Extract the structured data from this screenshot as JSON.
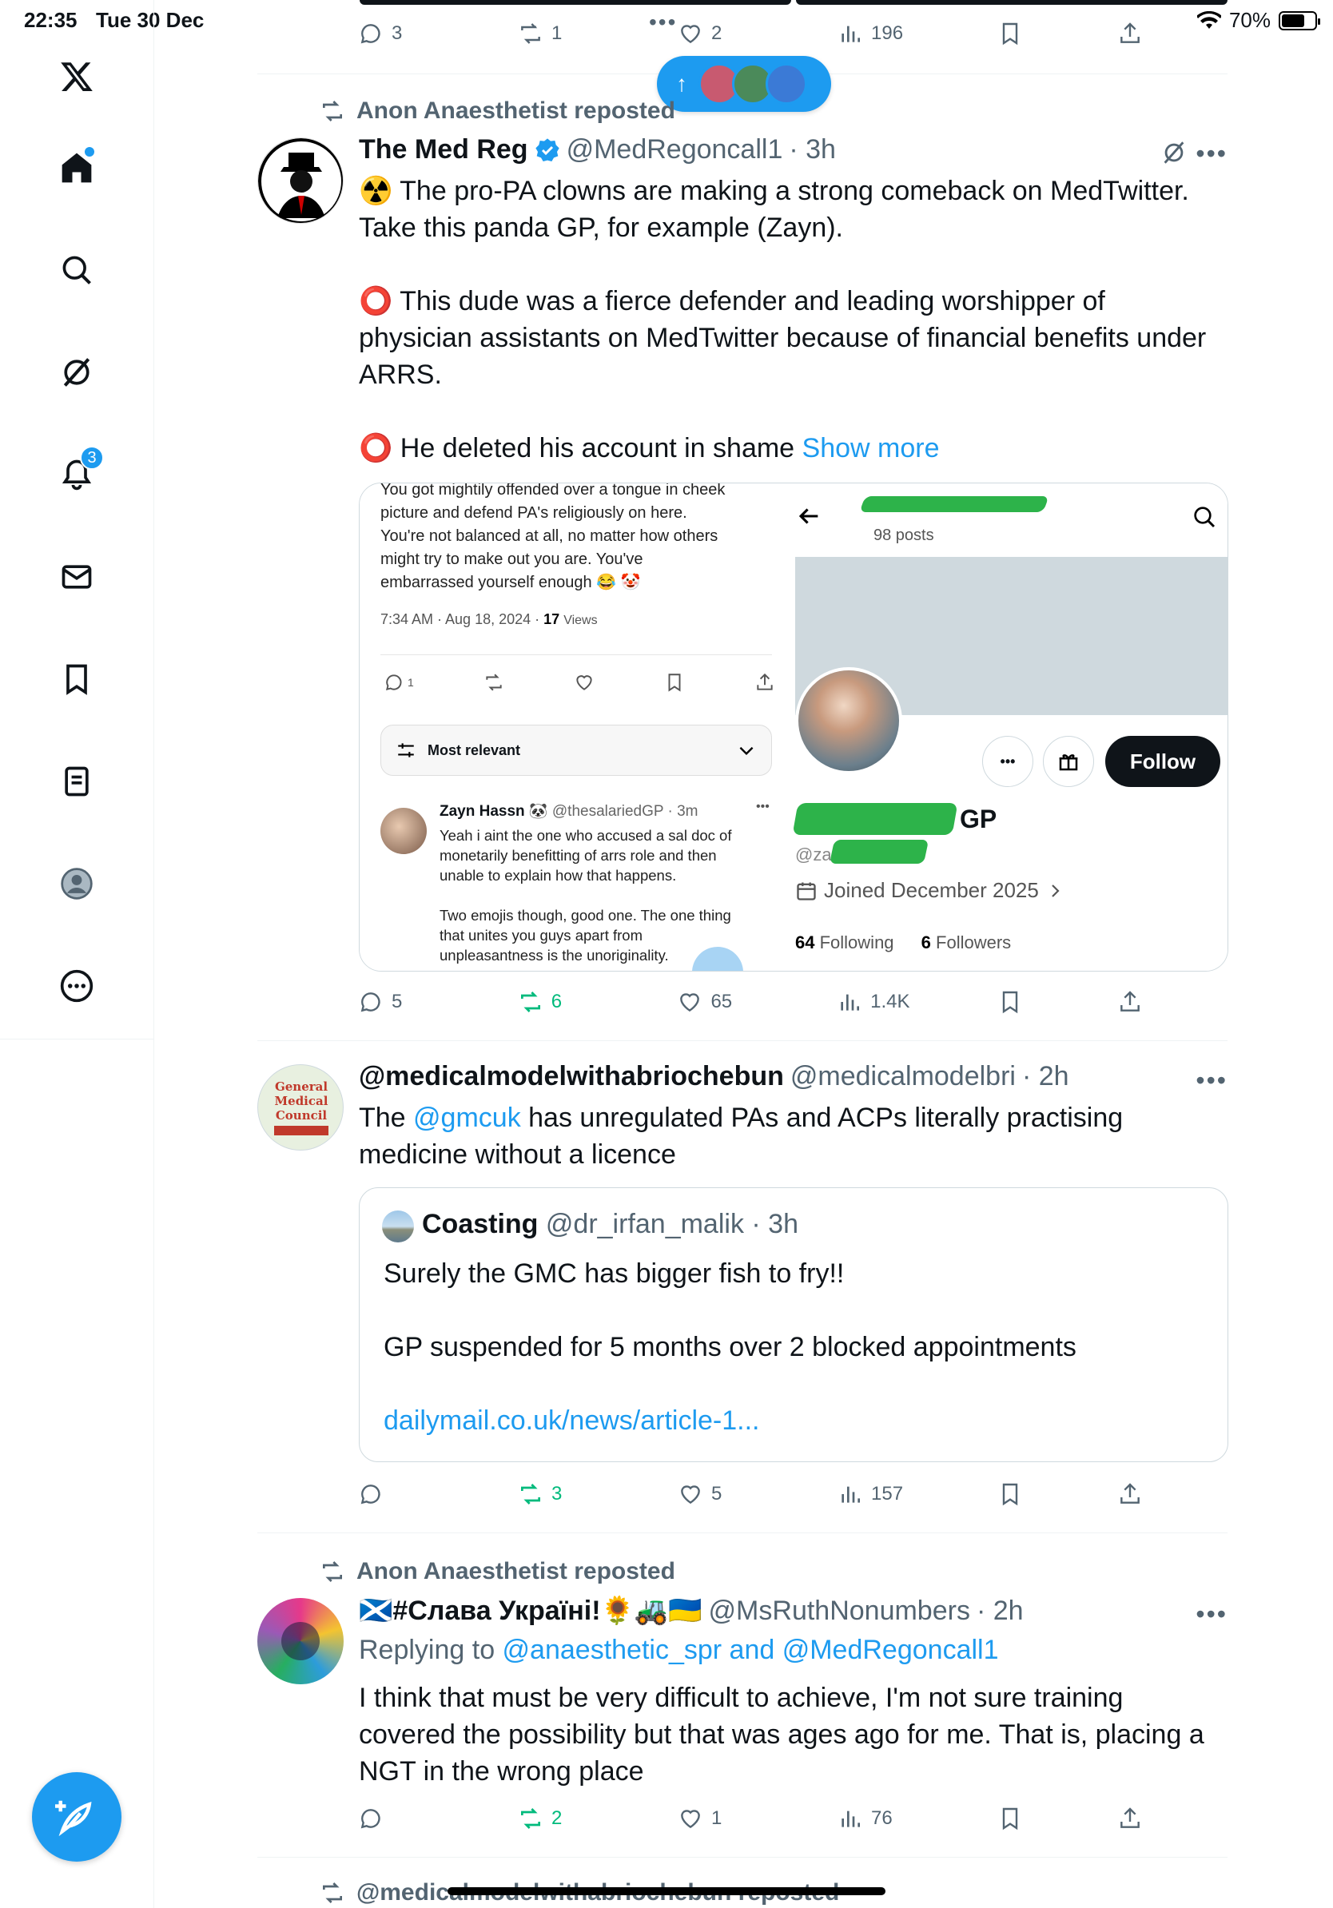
{
  "status_bar": {
    "time": "22:35",
    "date": "Tue 30 Dec",
    "battery": "70%",
    "battery_level": 0.7
  },
  "new_posts_pill": {
    "arrow": "↑",
    "colors": [
      "#c85a70",
      "#4b8a5a",
      "#3b7ad6"
    ]
  },
  "sidebar": {
    "items": [
      {
        "name": "home-icon"
      },
      {
        "name": "search-icon"
      },
      {
        "name": "grok-icon"
      },
      {
        "name": "notifications-icon",
        "badge": "3"
      },
      {
        "name": "messages-icon"
      },
      {
        "name": "bookmarks-icon"
      },
      {
        "name": "lists-icon"
      },
      {
        "name": "profile-icon"
      },
      {
        "name": "more-icon"
      }
    ]
  },
  "top_actions": {
    "replies": "3",
    "reposts": "1",
    "likes": "2",
    "views": "196"
  },
  "tweet1": {
    "repost_label": "Anon Anaesthetist reposted",
    "name": "The Med Reg",
    "handle": "@MedRegoncall1",
    "time": "· 3h",
    "line1": "☢️ The pro-PA clowns are making a strong comeback on MedTwitter.",
    "line2": "Take this panda GP, for example (Zayn).",
    "line3": "⭕ This dude was a fierce defender and leading worshipper of",
    "line4": "physician assistants on MedTwitter because of financial benefits under",
    "line5": "ARRS.",
    "line6": "⭕ He deleted his account in shame",
    "show_more": "Show more",
    "actions": {
      "replies": "5",
      "reposts": "6",
      "likes": "65",
      "views": "1.4K"
    },
    "media_left": {
      "text_lines": [
        "You got mightily offended over a tongue in cheek",
        "picture and defend PA's religiously on here.",
        "You're not balanced at all, no matter how others",
        "might try to make out you are. You've",
        "embarrassed yourself enough 😂 🤡"
      ],
      "time": "7:34 AM · Aug 18, 2024 ·",
      "views_n": "17",
      "views_label": "Views",
      "reply_count": "1",
      "sort": "Most relevant",
      "reply_name": "Zayn Hassn 🐼",
      "reply_handle": "@thesalariedGP · 3m",
      "reply_lines": [
        "Yeah i aint the one who accused a sal doc of",
        "monetarily benefitting of arrs role and then",
        "unable to explain how that happens.",
        "",
        "Two emojis though, good one. The one thing",
        "that unites you guys apart from",
        "unpleasantness is the unoriginality."
      ]
    },
    "media_right": {
      "posts": "98 posts",
      "follow": "Follow",
      "name_suffix": "GP",
      "handle_prefix": "@za",
      "joined": "Joined December 2025",
      "following_n": "64",
      "following_label": "Following",
      "followers_n": "6",
      "followers_label": "Followers"
    }
  },
  "tweet2": {
    "name": "@medicalmodelwithabriochebun",
    "handle": "@medicalmodelbri",
    "time": "· 2h",
    "text_a": "The ",
    "mention": "@gmcuk",
    "text_b": " has unregulated PAs and ACPs literally practising",
    "line2": "medicine without a licence",
    "avatar_text": [
      "General",
      "Medical",
      "Council"
    ],
    "quote": {
      "name": "Coasting",
      "handle": "@dr_irfan_malik · 3h",
      "line1": "Surely the GMC has bigger fish to fry!!",
      "line2": "GP suspended for 5 months over 2 blocked appointments",
      "link": "dailymail.co.uk/news/article-1..."
    },
    "actions": {
      "replies": "",
      "reposts": "3",
      "likes": "5",
      "views": "157"
    }
  },
  "tweet3": {
    "repost_label": "Anon Anaesthetist reposted",
    "name": "🏴󠁧󠁢󠁳󠁣󠁴󠁿#Слава Україні!🌻🚜🇺🇦",
    "handle": "@MsRuthNonumbers",
    "time": "· 2h",
    "replying_prefix": "Replying to ",
    "replying_handles": "@anaesthetic_spr and @MedRegoncall1",
    "line1": "I think that must be very difficult to achieve, I'm not sure training",
    "line2": "covered the possibility but that was ages ago for me. That is, placing a",
    "line3": "NGT in the wrong place",
    "actions": {
      "replies": "",
      "reposts": "2",
      "likes": "1",
      "views": "76"
    }
  },
  "tweet4": {
    "repost_label": "@medicalmodelwithabriochebun reposted"
  },
  "colors": {
    "accent": "#1d9bf0",
    "repost_green": "#00ba7c",
    "muted": "#536471"
  }
}
